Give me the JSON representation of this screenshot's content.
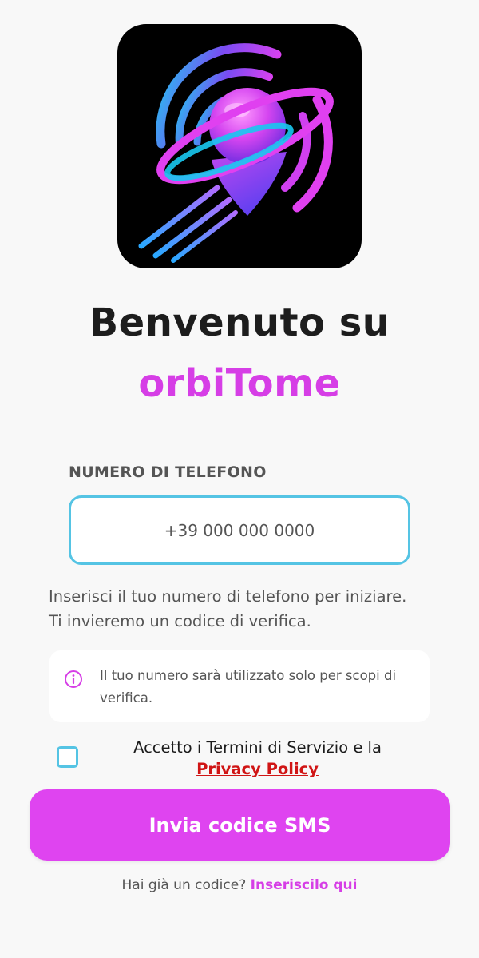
{
  "logo": {
    "icon": "orbit-location-pin-icon",
    "colors": {
      "cyan": "#18d4f0",
      "magenta": "#e040f0",
      "purple": "#8a3cf0",
      "background": "#000000"
    }
  },
  "welcome": {
    "line1": "Benvenuto su",
    "app_name": "orbiTome"
  },
  "phone": {
    "label": "NUMERO DI TELEFONO",
    "placeholder": "+39 000 000 0000",
    "value": ""
  },
  "helper": {
    "line1": "Inserisci il tuo numero di telefono per iniziare.",
    "line2": "Ti invieremo un codice di verifica."
  },
  "info": {
    "icon": "info-circle-icon",
    "text": "Il tuo numero sarà utilizzato solo per scopi di verifica."
  },
  "terms": {
    "checked": false,
    "text": "Accetto i Termini di Servizio e la",
    "privacy_link": "Privacy Policy"
  },
  "actions": {
    "send_sms_label": "Invia codice SMS"
  },
  "footer": {
    "text": "Hai già un codice?",
    "link": "Inseriscilo qui"
  },
  "theme": {
    "accent": "#df44f0",
    "input_border": "#55c4e4",
    "link_red": "#d01515"
  }
}
